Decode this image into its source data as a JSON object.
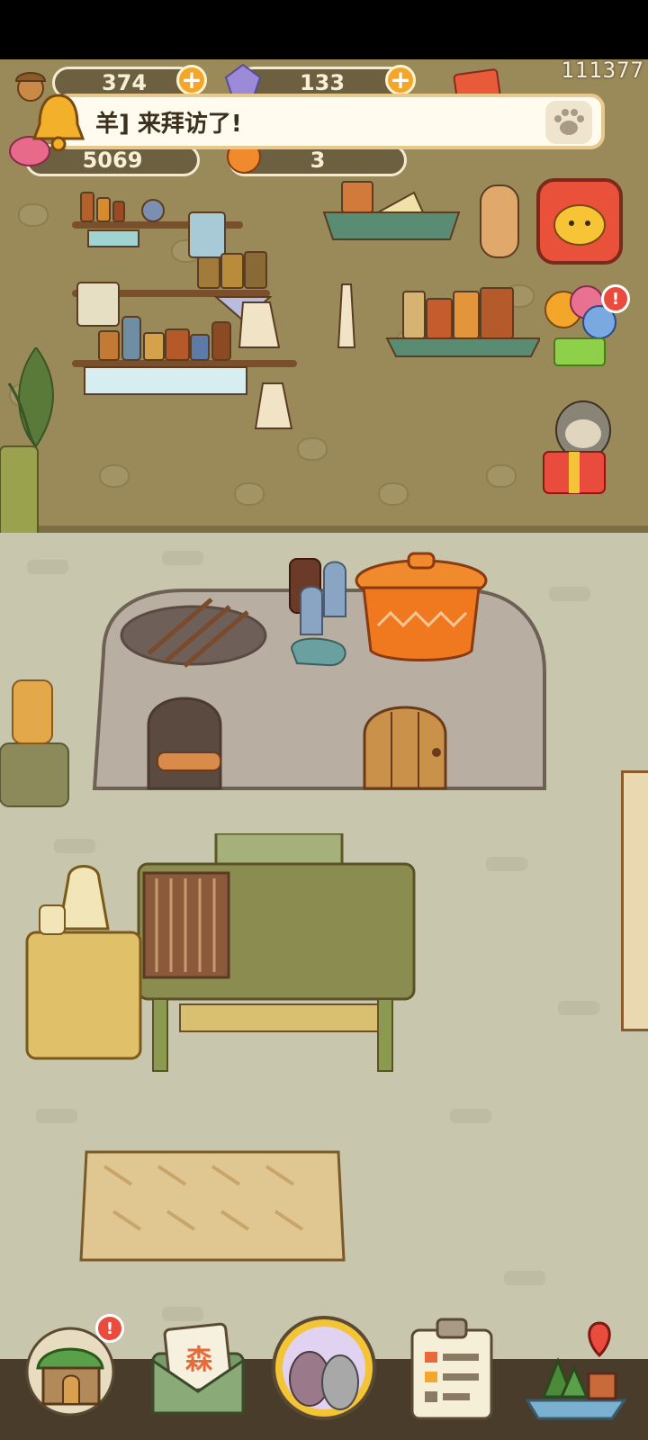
{
  "hud": {
    "acorn_count": "374",
    "crystal_count": "133",
    "meat_count": "5069",
    "orange_count": "3",
    "player_id": "111377"
  },
  "notice": {
    "text": "羊] 来拜访了!"
  },
  "side_buttons": {
    "tv_badge": "",
    "balloon_badge": "!"
  },
  "bottom_nav": {
    "home_badge": "!",
    "letter_label": "森"
  },
  "colors": {
    "wall": "#9a8a5a",
    "floor": "#c8c7ae",
    "accent_orange": "#f3a62a",
    "badge_red": "#e94b3c"
  },
  "icons": [
    "acorn-icon",
    "crystal-icon",
    "meat-icon",
    "orange-icon",
    "bell-icon",
    "paw-icon",
    "tv-icon",
    "balloon-gift-icon",
    "sloth-gift-icon",
    "home-icon",
    "letter-icon",
    "animal-portrait-icon",
    "recipe-clipboard-icon",
    "map-icon"
  ]
}
